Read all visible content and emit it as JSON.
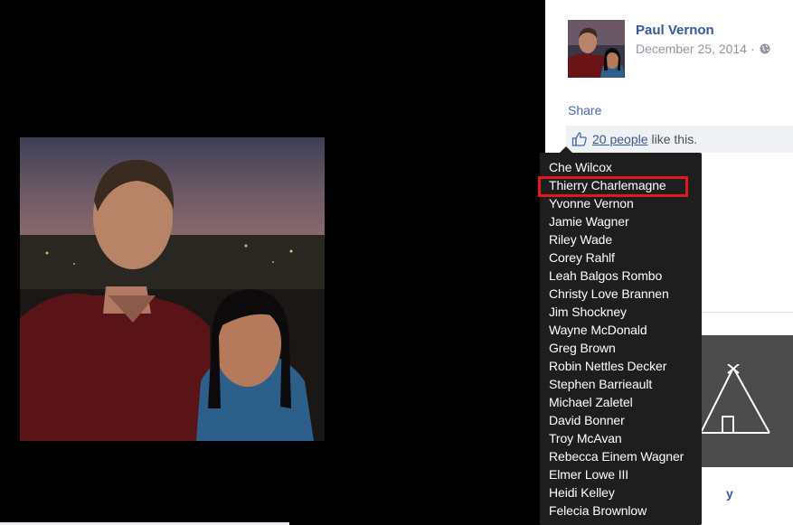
{
  "post": {
    "author": "Paul Vernon",
    "date": "December 25, 2014",
    "date_separator": "·",
    "privacy_icon": "globe-icon",
    "share_label": "Share",
    "likes_link": "20 people",
    "likes_suffix": "like this.",
    "like_icon": "thumbs-up-icon"
  },
  "likers_tooltip": {
    "names": [
      "Che Wilcox",
      "Thierry Charlemagne",
      "Yvonne Vernon",
      "Jamie Wagner",
      "Riley Wade",
      "Corey Rahlf",
      "Leah Balgos Rombo",
      "Christy Love Brannen",
      "Jim Shockney",
      "Wayne McDonald",
      "Greg Brown",
      "Robin Nettles Decker",
      "Stephen Barrieault",
      "Michael Zaletel",
      "David Bonner",
      "Troy McAvan",
      "Rebecca Einem Wagner",
      "Elmer Lowe III",
      "Heidi Kelley",
      "Felecia Brownlow"
    ],
    "highlighted_name": "Thierry Charlemagne",
    "highlight_color": "#e0191e"
  },
  "sidebar_ad": {
    "icon": "teepee-icon",
    "partial_link_text": "y"
  },
  "colors": {
    "link": "#365899",
    "tooltip_bg": "#1e1e1f",
    "likes_bar_bg": "#f0f1f4"
  }
}
